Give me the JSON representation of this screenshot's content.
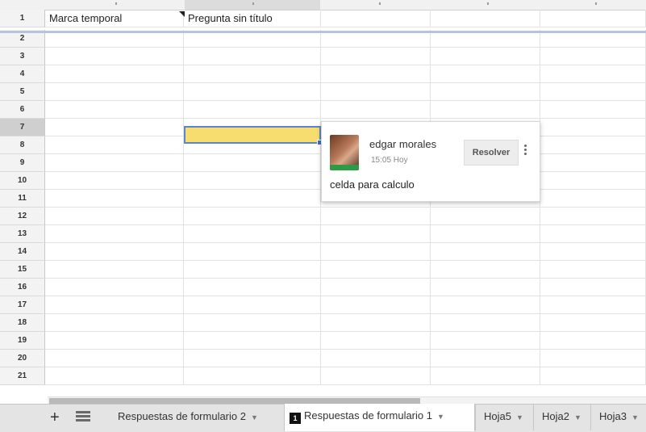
{
  "sheet": {
    "rows": [
      "1",
      "2",
      "3",
      "4",
      "5",
      "6",
      "7",
      "8",
      "9",
      "10",
      "11",
      "12",
      "13",
      "14",
      "15",
      "16",
      "17",
      "18",
      "19",
      "20",
      "21"
    ],
    "header_row": {
      "col_a": "Marca temporal",
      "col_b": "Pregunta sin título"
    },
    "active_row": "7",
    "selected_cell_color": "#f7dc6f"
  },
  "comment": {
    "author": "edgar morales",
    "time": "15:05 Hoy",
    "resolve_label": "Resolver",
    "text": "celda para calculo",
    "more_icon": "vertical-dots-icon"
  },
  "tabs": {
    "add_icon": "+",
    "list_icon": "sheet-list-icon",
    "items": [
      {
        "label": "Respuestas de formulario 2",
        "caret": "▼"
      },
      {
        "label": "Respuestas de formulario 1",
        "caret": "▼",
        "badge": "1",
        "active": true
      },
      {
        "label": "Hoja5",
        "caret": "▼"
      },
      {
        "label": "Hoja2",
        "caret": "▼"
      },
      {
        "label": "Hoja3",
        "caret": "▼"
      }
    ]
  }
}
